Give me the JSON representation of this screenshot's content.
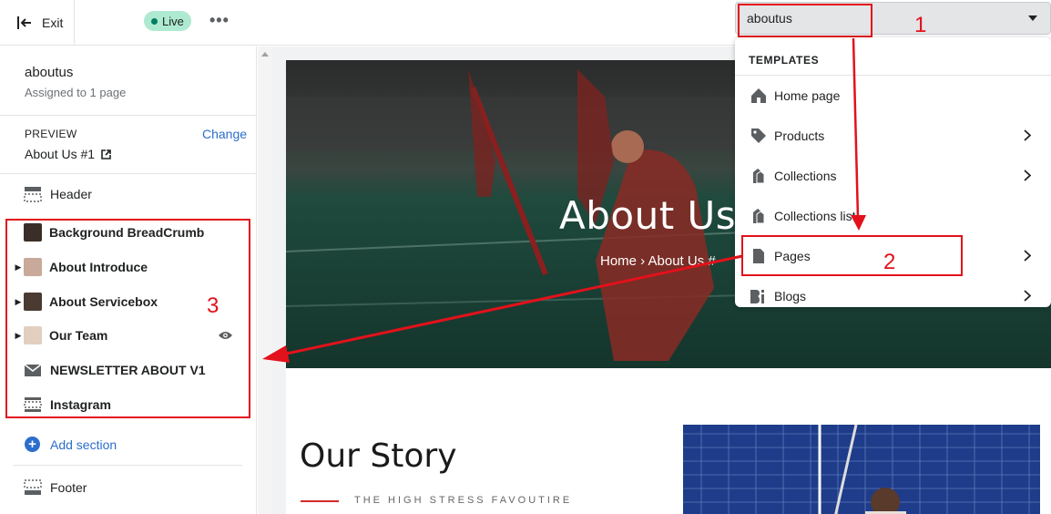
{
  "topbar": {
    "exit_label": "Exit",
    "status_badge": "Live",
    "more_label": "•••"
  },
  "sidebar": {
    "template_name": "aboutus",
    "template_sub": "Assigned to 1 page",
    "preview_label": "PREVIEW",
    "change_label": "Change",
    "preview_value": "About Us #1",
    "header_label": "Header",
    "sections": [
      {
        "label": "Background BreadCrumb",
        "expandable": false
      },
      {
        "label": "About Introduce",
        "expandable": true
      },
      {
        "label": "About Servicebox",
        "expandable": true
      },
      {
        "label": "Our Team",
        "expandable": true
      },
      {
        "label": "NEWSLETTER ABOUT V1",
        "expandable": false
      },
      {
        "label": "Instagram",
        "expandable": false
      }
    ],
    "add_section_label": "Add section",
    "footer_label": "Footer"
  },
  "annotations": {
    "n1": "1",
    "n2": "2",
    "n3": "3",
    "color": "#e3111b"
  },
  "preview_page": {
    "hero_title": "About Us",
    "breadcrumb": "Home  ›  About Us #",
    "story_title": "Our Story",
    "story_subtitle": "THE HIGH STRESS FAVOUTIRE"
  },
  "template_select": {
    "value": "aboutus",
    "menu_header": "TEMPLATES",
    "items": [
      {
        "label": "Home page",
        "icon": "home-icon",
        "submenu": false
      },
      {
        "label": "Products",
        "icon": "tag-icon",
        "submenu": true
      },
      {
        "label": "Collections",
        "icon": "collections-icon",
        "submenu": true
      },
      {
        "label": "Collections list",
        "icon": "collections-icon",
        "submenu": false
      },
      {
        "label": "Pages",
        "icon": "page-icon",
        "submenu": true
      },
      {
        "label": "Blogs",
        "icon": "blog-icon",
        "submenu": true
      }
    ]
  },
  "colors": {
    "accent": "#2c6ecb",
    "live_badge": "#aee9d1",
    "annotation_red": "#e3111b"
  }
}
